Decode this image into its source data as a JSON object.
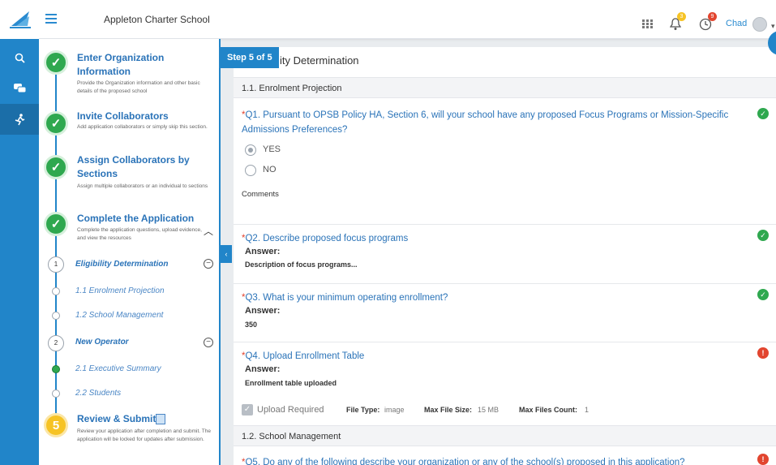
{
  "header": {
    "org_name": "Appleton Charter School",
    "user_name": "Chad",
    "bell_badge": "3",
    "clock_badge": "9",
    "accent": "#2185c9"
  },
  "steps": [
    {
      "title": "Enter Organization Information",
      "desc": "Provide the Organization information and other basic details of the proposed school",
      "state": "done"
    },
    {
      "title": "Invite Collaborators",
      "desc": "Add application collaborators or simply skip this section.",
      "state": "done"
    },
    {
      "title": "Assign Collaborators by Sections",
      "desc": "Assign multiple collaborators or an individual to sections",
      "state": "done"
    },
    {
      "title": "Complete the Application",
      "desc": "Complete the application questions, upload evidence, and view the resources",
      "state": "done"
    },
    {
      "title": "Review & Submit",
      "desc": "Review your application after completion and submit. The application will be locked for updates after submission.",
      "state": "pending",
      "number": "5"
    }
  ],
  "substeps": [
    {
      "number": "1",
      "title": "Eligibility Determination",
      "items": [
        "1.1 Enrolment Projection",
        "1.2 School Management"
      ]
    },
    {
      "number": "2",
      "title": "New Operator",
      "items": [
        "2.1 Executive Summary",
        "2.2 Students"
      ]
    }
  ],
  "main": {
    "step_badge": "Step 5 of 5",
    "title": "ity Determination",
    "section1": "1.1. Enrolment Projection",
    "section2": "1.2. School Management",
    "q1": "Q1. Pursuant to OPSB Policy HA, Section 6, will your school have any proposed Focus Programs or Mission-Specific",
    "q1_line2": "Admissions Preferences?",
    "q1_yes": "YES",
    "q1_no": "NO",
    "comments": "Comments",
    "q2": "Q2. Describe proposed focus programs",
    "q2_answer": "Description of focus programs...",
    "q3": "Q3. What is your minimum operating enrollment?",
    "q3_answer": "350",
    "q4": "Q4. Upload Enrollment Table",
    "q4_answer": "Enrollment table uploaded",
    "q5": "Q5. Do any of the following describe your organization or any of the school(s) proposed in this application?",
    "answer_label": "Answer:",
    "required_mark": "*",
    "upload_required": "Upload Required",
    "file_type_label": "File Type:",
    "file_type": "image",
    "max_size_label": "Max File Size:",
    "max_size": "15 MB",
    "max_count_label": "Max Files Count:",
    "max_count": "1"
  }
}
